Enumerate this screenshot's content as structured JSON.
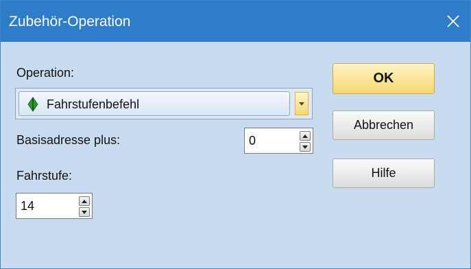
{
  "window": {
    "title": "Zubehör-Operation",
    "close_icon": "close-icon"
  },
  "form": {
    "operation_label": "Operation:",
    "operation_value": "Fahrstufenbefehl",
    "operation_icon": "green-diamond-icon",
    "basisadresse_label": "Basisadresse plus:",
    "basisadresse_value": "0",
    "fahrstufe_label": "Fahrstufe:",
    "fahrstufe_value": "14"
  },
  "buttons": {
    "ok_label": "OK",
    "cancel_label": "Abbrechen",
    "help_label": "Hilfe"
  },
  "colors": {
    "titlebar": "#2f7cc8",
    "background": "#c9dcef",
    "ok_button": "#f6d773",
    "operation_icon": "#2c9a2c"
  }
}
